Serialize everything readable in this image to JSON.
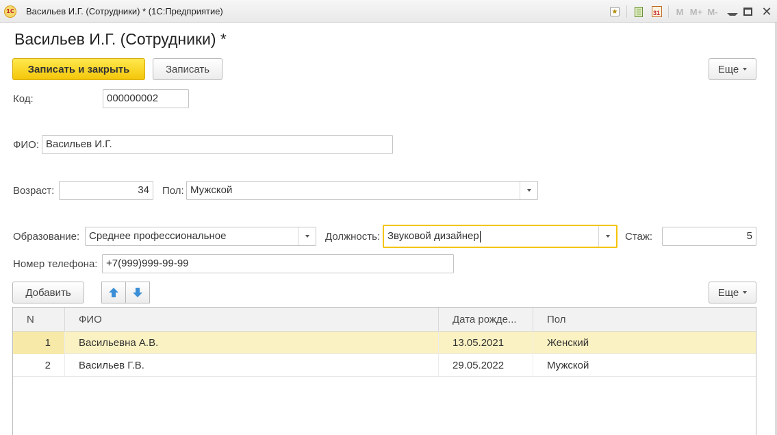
{
  "window": {
    "logo": "1С",
    "title": "Васильев И.Г. (Сотрудники) * (1С:Предприятие)",
    "m_buttons": [
      "M",
      "M+",
      "M-"
    ],
    "calendar_day": "31"
  },
  "page": {
    "title": "Васильев И.Г. (Сотрудники) *"
  },
  "toolbar": {
    "save_close_label": "Записать и закрыть",
    "save_label": "Записать",
    "more_label": "Еще"
  },
  "form": {
    "code": {
      "label": "Код:",
      "value": "000000002"
    },
    "fio": {
      "label": "ФИО:",
      "value": "Васильев И.Г."
    },
    "age": {
      "label": "Возраст:",
      "value": "34"
    },
    "gender": {
      "label": "Пол:",
      "value": "Мужской"
    },
    "education": {
      "label": "Образование:",
      "value": "Среднее профессиональное"
    },
    "position": {
      "label": "Должность:",
      "value": "Звуковой дизайнер"
    },
    "experience": {
      "label": "Стаж:",
      "value": "5"
    },
    "phone": {
      "label": "Номер телефона:",
      "value": "+7(999)999-99-99"
    }
  },
  "table_toolbar": {
    "add_label": "Добавить",
    "more_label": "Еще"
  },
  "table": {
    "columns": [
      "N",
      "ФИО",
      "Дата рожде...",
      "Пол"
    ],
    "rows": [
      {
        "n": "1",
        "fio": "Васильевна А.В.",
        "birth": "13.05.2021",
        "gender": "Женский"
      },
      {
        "n": "2",
        "fio": "Васильев Г.В.",
        "birth": "29.05.2022",
        "gender": "Мужской"
      }
    ]
  },
  "colors": {
    "accent": "#f4c60a",
    "selected_row": "#fbf2c3",
    "arrow": "#3a8fd6"
  }
}
